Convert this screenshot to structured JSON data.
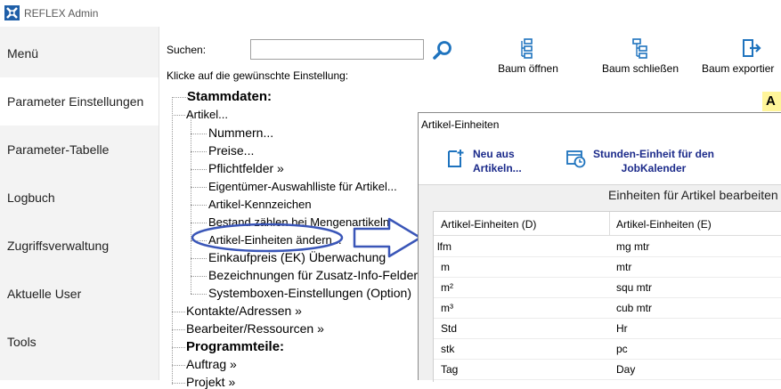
{
  "window": {
    "title": "REFLEX Admin"
  },
  "sidebar": {
    "items": [
      {
        "label": "Menü",
        "active": false
      },
      {
        "label": "Parameter Einstellungen",
        "active": true
      },
      {
        "label": "Parameter-Tabelle",
        "active": false
      },
      {
        "label": "Logbuch",
        "active": false
      },
      {
        "label": "Zugriffsverwaltung",
        "active": false
      },
      {
        "label": "Aktuelle User",
        "active": false
      },
      {
        "label": "Tools",
        "active": false
      }
    ]
  },
  "search": {
    "label": "Suchen:",
    "value": "",
    "placeholder": ""
  },
  "hint": "Klicke auf die gewünschte Einstellung:",
  "toolbar": {
    "open_tree": "Baum öffnen",
    "close_tree": "Baum schließen",
    "export_tree": "Baum exportier"
  },
  "tree": {
    "stammdaten": "Stammdaten:",
    "artikel": "Artikel...",
    "artikel_children": [
      "Nummern...",
      "Preise...",
      "Pflichtfelder »",
      "Eigentümer-Auswahlliste für Artikel...",
      "Artikel-Kennzeichen",
      "Bestand zählen bei Mengenartikeln",
      "Artikel-Einheiten ändern...",
      "Einkaufpreis (EK) Überwachung",
      "Bezeichnungen für Zusatz-Info-Felder",
      "Systemboxen-Einstellungen (Option)"
    ],
    "kontakte": "Kontakte/Adressen »",
    "bearbeiter": "Bearbeiter/Ressourcen »",
    "programmteile": "Programmteile:",
    "auftrag": "Auftrag »",
    "projekt": "Projekt »"
  },
  "badge": "A",
  "dialog": {
    "title": "Artikel-Einheiten",
    "btn_new": [
      "Neu aus",
      "Artikeln..."
    ],
    "btn_hours": [
      "Stunden-Einheit für den",
      "JobKalender"
    ],
    "heading": "Einheiten für Artikel bearbeiten",
    "columns": [
      "Artikel-Einheiten (D)",
      "Artikel-Einheiten (E)"
    ],
    "rows": [
      [
        "lfm",
        "mg mtr"
      ],
      [
        "m",
        "mtr"
      ],
      [
        "m²",
        "squ mtr"
      ],
      [
        "m³",
        "cub mtr"
      ],
      [
        "Std",
        "Hr"
      ],
      [
        "stk",
        "pc"
      ],
      [
        "Tag",
        "Day"
      ]
    ]
  },
  "colors": {
    "accent": "#1e73be",
    "callout": "#3a56b8",
    "badge": "#fff59a"
  }
}
